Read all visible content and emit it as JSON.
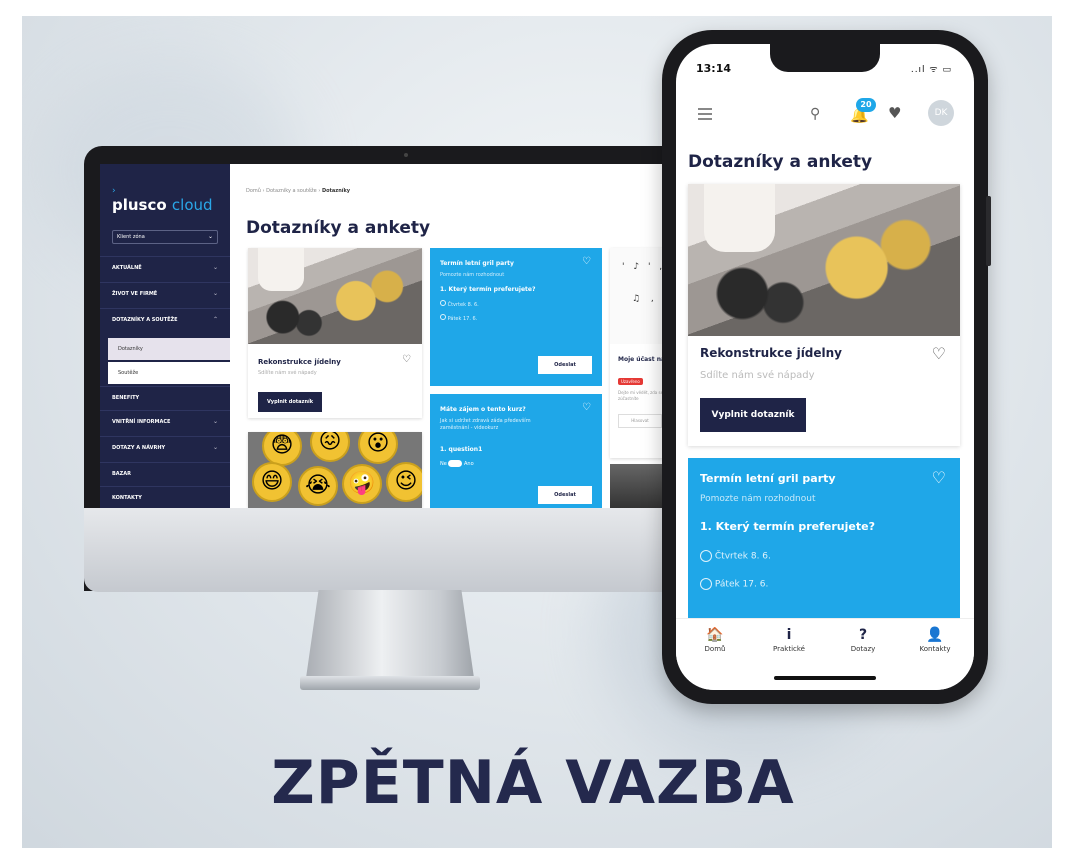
{
  "desktop": {
    "logo_main": "plusco",
    "logo_suffix": "cloud",
    "select_label": "Klient zóna",
    "nav": [
      {
        "label": "AKTUÁLNĚ"
      },
      {
        "label": "ŽIVOT VE FIRMĚ"
      },
      {
        "label": "DOTAZNÍKY A SOUTĚŽE"
      },
      {
        "label": "BENEFITY"
      },
      {
        "label": "VNITŘNÍ INFORMACE"
      },
      {
        "label": "DOTAZY A NÁVRHY"
      },
      {
        "label": "BAZAR"
      },
      {
        "label": "KONTAKTY"
      }
    ],
    "subnav": [
      {
        "label": "Dotazníky"
      },
      {
        "label": "Soutěže"
      }
    ],
    "breadcrumb": {
      "home": "Domů",
      "parent": "Dotazníky a soutěže",
      "current": "Dotazníky"
    },
    "page_title": "Dotazníky a ankety",
    "card_food": {
      "title": "Rekonstrukce jídelny",
      "subtitle": "Sdílíte nám své nápady",
      "button": "Vyplnit dotazník"
    },
    "card_grill": {
      "title": "Termín letní gril party",
      "subtitle": "Pomozte nám rozhodnout",
      "question": "1. Který termín preferujete?",
      "options": [
        "Čtvrtek 8. 6.",
        "Pátek 17. 6."
      ],
      "button": "Odeslat"
    },
    "card_course": {
      "title": "Máte zájem o tento kurz?",
      "subtitle": "Jak si udržet zdravá záda především zaměstnání - videokurz",
      "question": "1. question1",
      "toggle_no": "Ne",
      "toggle_yes": "Ano",
      "button": "Odeslat"
    },
    "card_party": {
      "title": "Moje účast na párty",
      "badge": "Uzavřeno",
      "text": "Dejte mi vědět, zda se zúčastníte",
      "button": "Hlasovat"
    }
  },
  "phone": {
    "time": "13:14",
    "status": "..ıl ᯤ ▭",
    "notification_count": "20",
    "avatar_initials": "DK",
    "page_title": "Dotazníky a ankety",
    "card_food": {
      "title": "Rekonstrukce jídelny",
      "subtitle": "Sdílte nám své nápady",
      "button": "Vyplnit dotazník"
    },
    "card_grill": {
      "title": "Termín letní gril party",
      "subtitle": "Pomozte nám rozhodnout",
      "question": "1. Který termín preferujete?",
      "options": [
        "Čtvrtek 8. 6.",
        "Pátek 17. 6."
      ]
    },
    "tabs": [
      {
        "label": "Domů",
        "icon": "home-icon",
        "glyph": "🏠"
      },
      {
        "label": "Praktické",
        "icon": "info-icon",
        "glyph": "i"
      },
      {
        "label": "Dotazy",
        "icon": "question-icon",
        "glyph": "?"
      },
      {
        "label": "Kontakty",
        "icon": "contacts-icon",
        "glyph": "👤"
      }
    ]
  },
  "headline": "ZPĚTNÁ VAZBA",
  "colors": {
    "navy": "#1f2447",
    "accent_blue": "#1fa7e8",
    "headline": "#24294d"
  }
}
